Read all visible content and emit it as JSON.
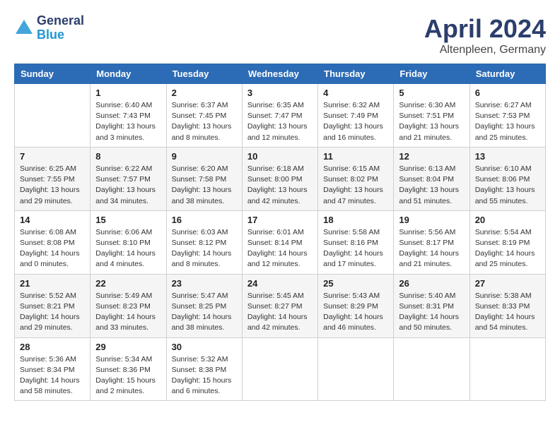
{
  "header": {
    "logo_general": "General",
    "logo_blue": "Blue",
    "month": "April 2024",
    "location": "Altenpleen, Germany"
  },
  "weekdays": [
    "Sunday",
    "Monday",
    "Tuesday",
    "Wednesday",
    "Thursday",
    "Friday",
    "Saturday"
  ],
  "weeks": [
    [
      {
        "day": "",
        "info": ""
      },
      {
        "day": "1",
        "info": "Sunrise: 6:40 AM\nSunset: 7:43 PM\nDaylight: 13 hours\nand 3 minutes."
      },
      {
        "day": "2",
        "info": "Sunrise: 6:37 AM\nSunset: 7:45 PM\nDaylight: 13 hours\nand 8 minutes."
      },
      {
        "day": "3",
        "info": "Sunrise: 6:35 AM\nSunset: 7:47 PM\nDaylight: 13 hours\nand 12 minutes."
      },
      {
        "day": "4",
        "info": "Sunrise: 6:32 AM\nSunset: 7:49 PM\nDaylight: 13 hours\nand 16 minutes."
      },
      {
        "day": "5",
        "info": "Sunrise: 6:30 AM\nSunset: 7:51 PM\nDaylight: 13 hours\nand 21 minutes."
      },
      {
        "day": "6",
        "info": "Sunrise: 6:27 AM\nSunset: 7:53 PM\nDaylight: 13 hours\nand 25 minutes."
      }
    ],
    [
      {
        "day": "7",
        "info": "Sunrise: 6:25 AM\nSunset: 7:55 PM\nDaylight: 13 hours\nand 29 minutes."
      },
      {
        "day": "8",
        "info": "Sunrise: 6:22 AM\nSunset: 7:57 PM\nDaylight: 13 hours\nand 34 minutes."
      },
      {
        "day": "9",
        "info": "Sunrise: 6:20 AM\nSunset: 7:58 PM\nDaylight: 13 hours\nand 38 minutes."
      },
      {
        "day": "10",
        "info": "Sunrise: 6:18 AM\nSunset: 8:00 PM\nDaylight: 13 hours\nand 42 minutes."
      },
      {
        "day": "11",
        "info": "Sunrise: 6:15 AM\nSunset: 8:02 PM\nDaylight: 13 hours\nand 47 minutes."
      },
      {
        "day": "12",
        "info": "Sunrise: 6:13 AM\nSunset: 8:04 PM\nDaylight: 13 hours\nand 51 minutes."
      },
      {
        "day": "13",
        "info": "Sunrise: 6:10 AM\nSunset: 8:06 PM\nDaylight: 13 hours\nand 55 minutes."
      }
    ],
    [
      {
        "day": "14",
        "info": "Sunrise: 6:08 AM\nSunset: 8:08 PM\nDaylight: 14 hours\nand 0 minutes."
      },
      {
        "day": "15",
        "info": "Sunrise: 6:06 AM\nSunset: 8:10 PM\nDaylight: 14 hours\nand 4 minutes."
      },
      {
        "day": "16",
        "info": "Sunrise: 6:03 AM\nSunset: 8:12 PM\nDaylight: 14 hours\nand 8 minutes."
      },
      {
        "day": "17",
        "info": "Sunrise: 6:01 AM\nSunset: 8:14 PM\nDaylight: 14 hours\nand 12 minutes."
      },
      {
        "day": "18",
        "info": "Sunrise: 5:58 AM\nSunset: 8:16 PM\nDaylight: 14 hours\nand 17 minutes."
      },
      {
        "day": "19",
        "info": "Sunrise: 5:56 AM\nSunset: 8:17 PM\nDaylight: 14 hours\nand 21 minutes."
      },
      {
        "day": "20",
        "info": "Sunrise: 5:54 AM\nSunset: 8:19 PM\nDaylight: 14 hours\nand 25 minutes."
      }
    ],
    [
      {
        "day": "21",
        "info": "Sunrise: 5:52 AM\nSunset: 8:21 PM\nDaylight: 14 hours\nand 29 minutes."
      },
      {
        "day": "22",
        "info": "Sunrise: 5:49 AM\nSunset: 8:23 PM\nDaylight: 14 hours\nand 33 minutes."
      },
      {
        "day": "23",
        "info": "Sunrise: 5:47 AM\nSunset: 8:25 PM\nDaylight: 14 hours\nand 38 minutes."
      },
      {
        "day": "24",
        "info": "Sunrise: 5:45 AM\nSunset: 8:27 PM\nDaylight: 14 hours\nand 42 minutes."
      },
      {
        "day": "25",
        "info": "Sunrise: 5:43 AM\nSunset: 8:29 PM\nDaylight: 14 hours\nand 46 minutes."
      },
      {
        "day": "26",
        "info": "Sunrise: 5:40 AM\nSunset: 8:31 PM\nDaylight: 14 hours\nand 50 minutes."
      },
      {
        "day": "27",
        "info": "Sunrise: 5:38 AM\nSunset: 8:33 PM\nDaylight: 14 hours\nand 54 minutes."
      }
    ],
    [
      {
        "day": "28",
        "info": "Sunrise: 5:36 AM\nSunset: 8:34 PM\nDaylight: 14 hours\nand 58 minutes."
      },
      {
        "day": "29",
        "info": "Sunrise: 5:34 AM\nSunset: 8:36 PM\nDaylight: 15 hours\nand 2 minutes."
      },
      {
        "day": "30",
        "info": "Sunrise: 5:32 AM\nSunset: 8:38 PM\nDaylight: 15 hours\nand 6 minutes."
      },
      {
        "day": "",
        "info": ""
      },
      {
        "day": "",
        "info": ""
      },
      {
        "day": "",
        "info": ""
      },
      {
        "day": "",
        "info": ""
      }
    ]
  ]
}
